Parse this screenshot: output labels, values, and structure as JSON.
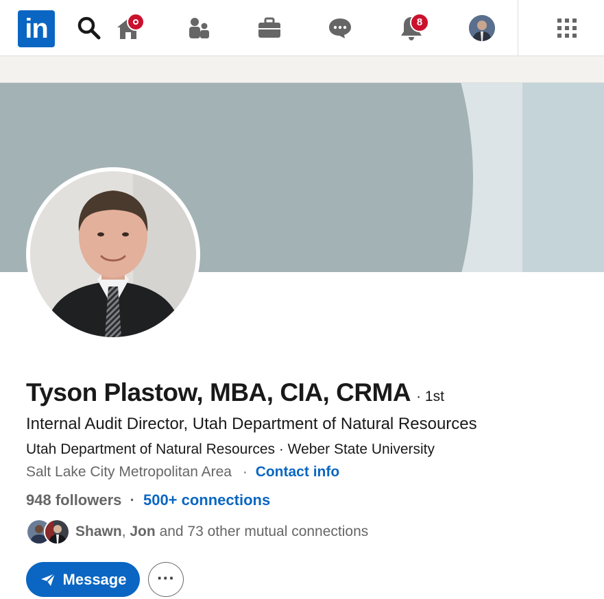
{
  "nav": {
    "logo_text": "in",
    "notifications_count": "8",
    "icons": [
      "linkedin-logo",
      "search-icon",
      "home-icon",
      "my-network-icon",
      "jobs-icon",
      "messaging-icon",
      "notifications-icon",
      "me-avatar",
      "grid-apps-icon"
    ]
  },
  "profile": {
    "name": "Tyson Plastow, MBA, CIA, CRMA",
    "degree": "· 1st",
    "headline": "Internal Audit Director, Utah Department of Natural Resources",
    "organizations": "Utah Department of Natural Resources · Weber State University",
    "location": "Salt Lake City Metropolitan Area",
    "location_sep": "·",
    "contact_info": "Contact info",
    "followers": "948 followers",
    "stats_sep": "·",
    "connections": "500+ connections",
    "mutual_name_1": "Shawn",
    "mutual_sep": ",",
    "mutual_name_2": "Jon",
    "mutual_rest": "and 73 other mutual connections"
  },
  "actions": {
    "message_label": "Message",
    "more_label": "···"
  },
  "colors": {
    "brand": "#0a66c2",
    "badge": "#cb112d",
    "banner": "#a3b2b5"
  }
}
